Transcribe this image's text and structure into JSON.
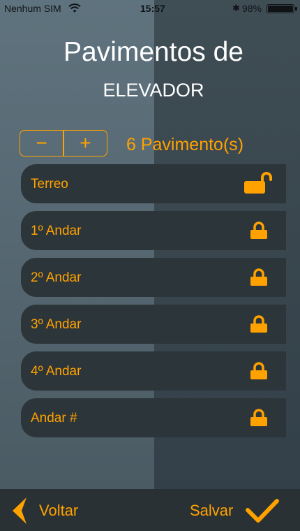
{
  "status": {
    "carrier": "Nenhum SIM",
    "time": "15:57",
    "battery": "98%"
  },
  "title": {
    "line1": "Pavimentos de",
    "line2": "ELEVADOR"
  },
  "stepper": {
    "minus": "−",
    "plus": "+",
    "count_label": "6 Pavimento(s)"
  },
  "floors": [
    {
      "label": "Terreo",
      "lock": "unlocked"
    },
    {
      "label": "1º Andar",
      "lock": "locked"
    },
    {
      "label": "2º Andar",
      "lock": "locked"
    },
    {
      "label": "3º Andar",
      "lock": "locked"
    },
    {
      "label": "4º Andar",
      "lock": "locked"
    },
    {
      "label": "Andar #",
      "lock": "locked"
    }
  ],
  "footer": {
    "back": "Voltar",
    "save": "Salvar"
  },
  "colors": {
    "accent": "#ffa200",
    "row_bg": "#2c3539",
    "bar_bg": "#2a3134"
  },
  "icons": {
    "wifi": "wifi-icon",
    "bluetooth": "bluetooth-icon",
    "battery": "battery-icon",
    "lock_open": "lock-open-icon",
    "lock_closed": "lock-closed-icon",
    "back": "chevron-left-icon",
    "save": "checkmark-icon"
  }
}
